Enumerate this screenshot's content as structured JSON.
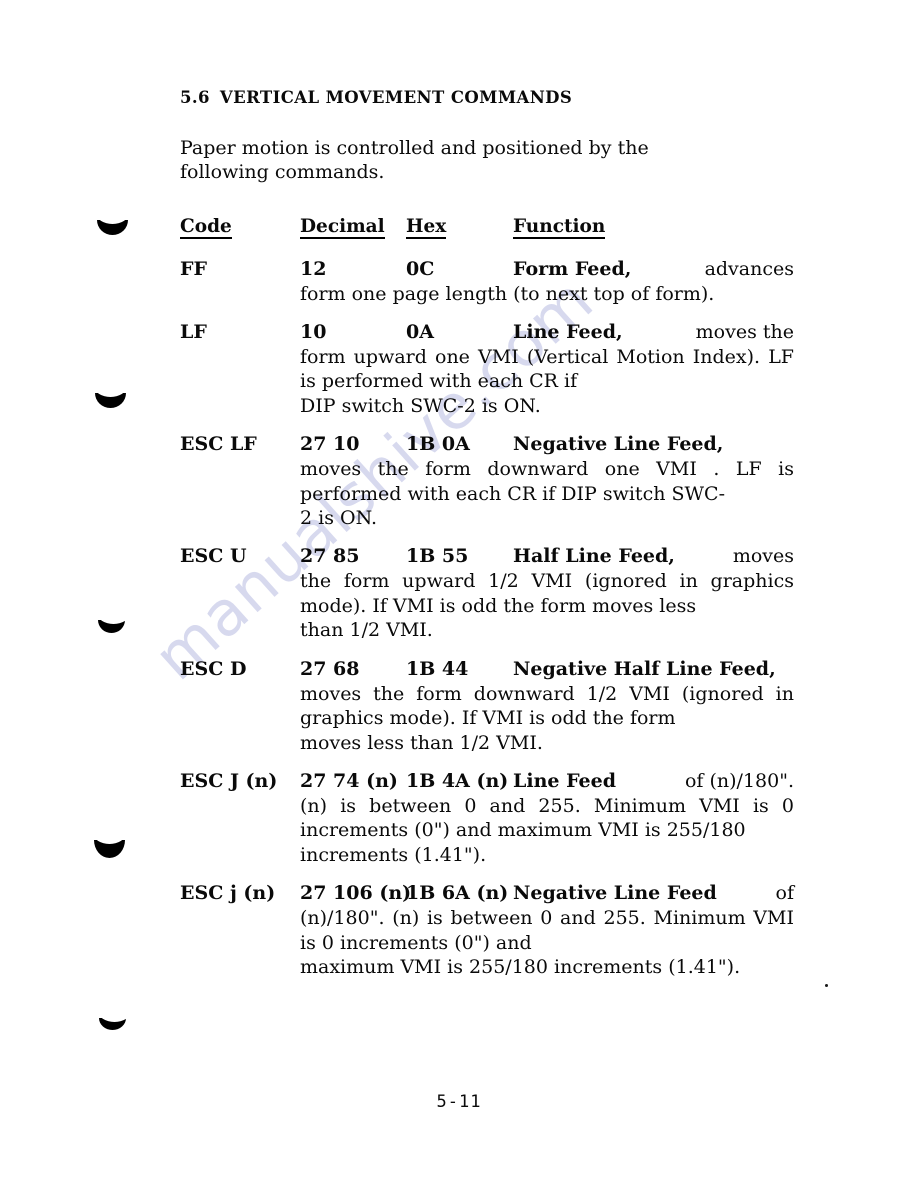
{
  "page": {
    "watermark": "manualshive.com",
    "footer_page_number": "5-11",
    "ink_color": "#0a0a0a",
    "watermark_color": "#c8cbe8",
    "background_color": "#ffffff"
  },
  "section": {
    "number": "5.6",
    "title": "VERTICAL MOVEMENT COMMANDS",
    "intro_line1": "Paper  motion  is  controlled  and  positioned  by  the",
    "intro_line2": "following commands."
  },
  "table": {
    "headers": {
      "code": "Code",
      "decimal": "Decimal",
      "hex": "Hex",
      "function": "Function"
    },
    "rows": [
      {
        "code": "FF",
        "decimal": "12",
        "hex": "0C",
        "function_name": "Form   Feed,",
        "first_tail": "advances",
        "body": "form one page length (to next top of form)."
      },
      {
        "code": "LF",
        "decimal": "10",
        "hex": "0A",
        "function_name": "Line   Feed,",
        "first_tail": "moves   the",
        "body": "form   upward   one   VMI   (Vertical   Motion Index).   LF  is  performed  with  each  CR  if",
        "body_tail": "DIP switch SWC-2 is ON."
      },
      {
        "code": "ESC LF",
        "decimal": "27 10",
        "hex": "1B 0A",
        "function_name": "Negative      Line      Feed,",
        "first_tail": "",
        "body": "moves  the  form  downward  one  VMI .   LF  is performed  with  each  CR  if  DIP  switch  SWC-",
        "body_tail": "2 is ON."
      },
      {
        "code": "ESC U",
        "decimal": "27 85",
        "hex": "1B 55",
        "function_name": "Half  Line  Feed,",
        "first_tail": "moves",
        "body": "the form upward 1/2 VMI (ignored in graphics mode).   If  VMI  is  odd  the  form  moves  less",
        "body_tail": "than 1/2 VMI."
      },
      {
        "code": "ESC D",
        "decimal": "27 68",
        "hex": "1B 44",
        "function_name": "Negative Half Line Feed,",
        "first_tail": "",
        "body": "moves  the  form  downward  1/2  VMI  (ignored in  graphics  mode).   If  VMI  is  odd  the  form",
        "body_tail": "moves less than 1/2 VMI."
      },
      {
        "code": "ESC J (n)",
        "decimal": "27 74 (n)",
        "hex": "1B 4A (n)",
        "function_name": "Line   Feed",
        "first_tail": "of   (n)/180\".",
        "body": "(n) is between 0 and 255.  Minimum VMI is 0 increments (0\") and maximum VMI is 255/180",
        "body_tail": "increments (1.41\")."
      },
      {
        "code": "ESC j (n)",
        "decimal": "27 106 (n)",
        "hex": "1B 6A (n)",
        "function_name": "Negative  Line  Feed",
        "first_tail": "of",
        "body": "(n)/180\".      (n)  is  between  0  and  255. Minimum   VMI   is   0   increments   (0\")   and",
        "body_tail": "maximum VMI is 255/180 increments (1.41\")."
      }
    ]
  }
}
